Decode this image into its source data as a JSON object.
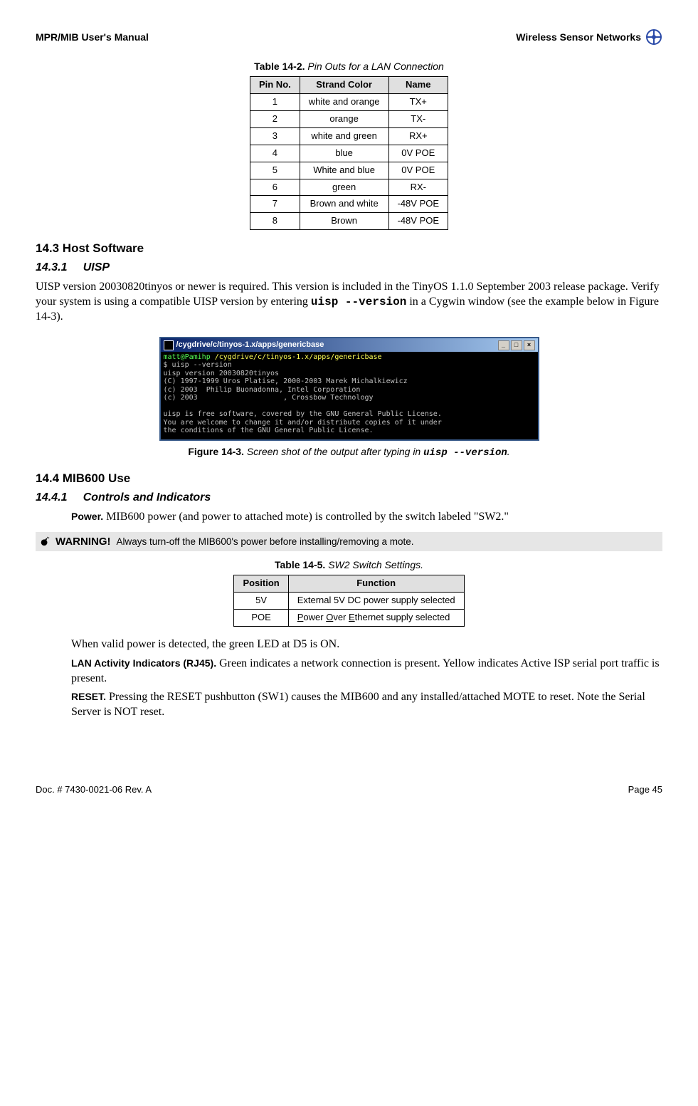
{
  "header": {
    "left": "MPR/MIB User's Manual",
    "right": "Wireless Sensor Networks"
  },
  "table14_2": {
    "caption_label": "Table 14-2.",
    "caption_text": "Pin Outs for a LAN Connection",
    "headers": [
      "Pin No.",
      "Strand Color",
      "Name"
    ],
    "rows": [
      [
        "1",
        "white and orange",
        "TX+"
      ],
      [
        "2",
        "orange",
        "TX-"
      ],
      [
        "3",
        "white and green",
        "RX+"
      ],
      [
        "4",
        "blue",
        "0V POE"
      ],
      [
        "5",
        "White and blue",
        "0V POE"
      ],
      [
        "6",
        "green",
        "RX-"
      ],
      [
        "7",
        "Brown and white",
        "-48V POE"
      ],
      [
        "8",
        "Brown",
        "-48V POE"
      ]
    ]
  },
  "s14_3": {
    "heading": "14.3    Host Software",
    "sub_heading_num": "14.3.1",
    "sub_heading_title": "UISP",
    "para_pre": "UISP version 20030820tinyos or newer is required. This version is included in the TinyOS 1.1.0 September 2003 release package. Verify your system is using a compatible UISP version by entering ",
    "para_code": "uisp --version",
    "para_post": " in a Cygwin window (see the example below in Figure 14-3)."
  },
  "terminal": {
    "title": "/cygdrive/c/tinyos-1.x/apps/genericbase",
    "prompt_user": "matt@Pamihp ",
    "prompt_path": "/cygdrive/c/tinyos-1.x/apps/genericbase",
    "lines": [
      "$ uisp --version",
      "uisp version 20030820tinyos",
      "(C) 1997-1999 Uros Platise, 2000-2003 Marek Michalkiewicz",
      "(c) 2003  Philip Buonadonna, Intel Corporation",
      "(c) 2003                    , Crossbow Technology",
      "",
      "uisp is free software, covered by the GNU General Public License.",
      "You are welcome to change it and/or distribute copies of it under",
      "the conditions of the GNU General Public License."
    ]
  },
  "figure14_3": {
    "label": "Figure 14-3.",
    "text_pre": "Screen shot of the output after typing in ",
    "code": "uisp --version",
    "text_post": "."
  },
  "s14_4": {
    "heading": "14.4    MIB600 Use",
    "sub_heading_num": "14.4.1",
    "sub_heading_title": "Controls and Indicators",
    "power_label": "Power.",
    "power_text": " MIB600 power (and power to attached mote) is controlled by the switch labeled \"SW2.\""
  },
  "warning": {
    "label": "WARNING!",
    "text": " Always turn-off the MIB600's power before installing/removing a mote."
  },
  "table14_5": {
    "caption_label": "Table 14-5.",
    "caption_text": "SW2 Switch Settings.",
    "headers": [
      "Position",
      "Function"
    ],
    "rows": [
      [
        "5V",
        "External 5V DC power supply selected"
      ]
    ],
    "poe_pos": "POE",
    "poe_func_p": "P",
    "poe_func_mid1": "ower ",
    "poe_func_o": "O",
    "poe_func_mid2": "ver ",
    "poe_func_e": "E",
    "poe_func_end": "thernet supply selected"
  },
  "tail": {
    "p1": "When valid power is detected, the green LED at D5 is ON.",
    "lan_label": "LAN Activity Indicators (RJ45).",
    "lan_text": " Green indicates a network connection is present. Yellow indicates Active ISP serial port traffic is present.",
    "reset_label": "RESET.",
    "reset_text": " Pressing the RESET pushbutton (SW1) causes the MIB600 and any installed/attached MOTE to reset. Note the Serial Server is NOT reset."
  },
  "footer": {
    "left": "Doc. # 7430-0021-06 Rev. A",
    "right": "Page 45"
  },
  "chart_data": [
    {
      "type": "table",
      "title": "Table 14-2. Pin Outs for a LAN Connection",
      "columns": [
        "Pin No.",
        "Strand Color",
        "Name"
      ],
      "rows": [
        [
          1,
          "white and orange",
          "TX+"
        ],
        [
          2,
          "orange",
          "TX-"
        ],
        [
          3,
          "white and green",
          "RX+"
        ],
        [
          4,
          "blue",
          "0V POE"
        ],
        [
          5,
          "White and blue",
          "0V POE"
        ],
        [
          6,
          "green",
          "RX-"
        ],
        [
          7,
          "Brown and white",
          "-48V POE"
        ],
        [
          8,
          "Brown",
          "-48V POE"
        ]
      ]
    },
    {
      "type": "table",
      "title": "Table 14-5. SW2 Switch Settings.",
      "columns": [
        "Position",
        "Function"
      ],
      "rows": [
        [
          "5V",
          "External 5V DC power supply selected"
        ],
        [
          "POE",
          "Power Over Ethernet supply selected"
        ]
      ]
    }
  ]
}
